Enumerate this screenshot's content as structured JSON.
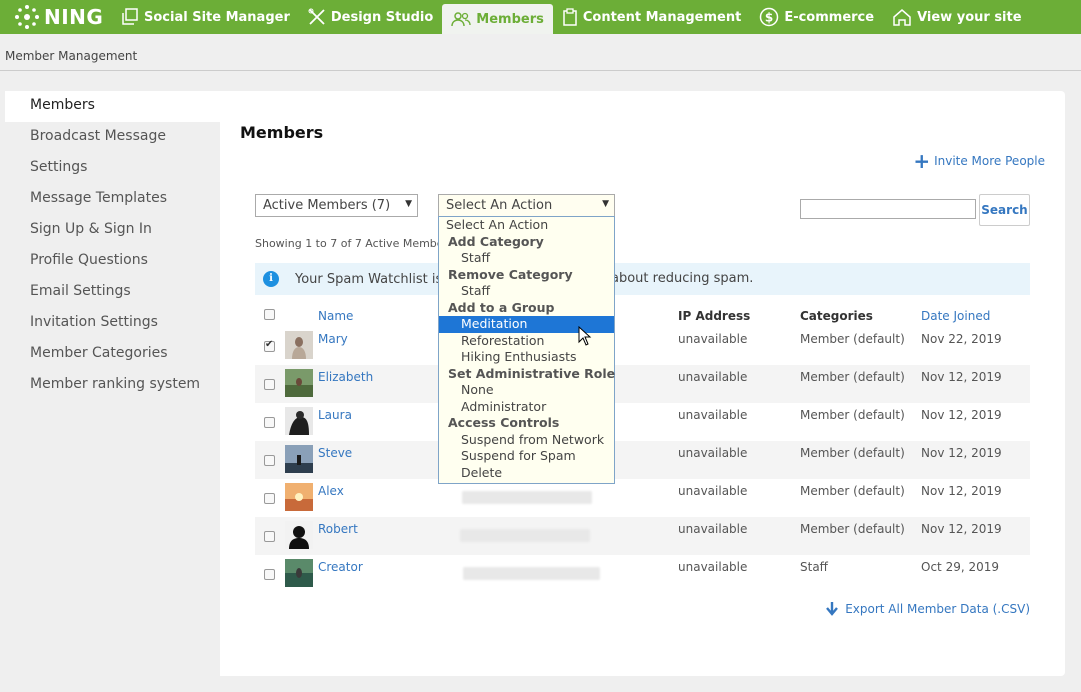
{
  "nav": {
    "logo": "NING",
    "items": [
      {
        "label": "Social Site Manager"
      },
      {
        "label": "Design Studio"
      },
      {
        "label": "Members"
      },
      {
        "label": "Content Management"
      },
      {
        "label": "E-commerce"
      },
      {
        "label": "View your site"
      }
    ]
  },
  "breadcrumb": "Member Management",
  "sidebar": {
    "items": [
      {
        "label": "Members"
      },
      {
        "label": "Broadcast Message"
      },
      {
        "label": "Settings"
      },
      {
        "label": "Message Templates"
      },
      {
        "label": "Sign Up & Sign In"
      },
      {
        "label": "Profile Questions"
      },
      {
        "label": "Email Settings"
      },
      {
        "label": "Invitation Settings"
      },
      {
        "label": "Member Categories"
      },
      {
        "label": "Member ranking system"
      }
    ]
  },
  "main": {
    "title": "Members",
    "invite": "Invite More People",
    "filter_select": "Active Members (7)",
    "action_select": "Select An Action",
    "search_button": "Search",
    "showing": "Showing 1 to 7 of 7 Active Members",
    "info_text_left": "Your Spam Watchlist is",
    "info_text_right": "about reducing spam.",
    "columns": {
      "name": "Name",
      "ip": "IP Address",
      "categories": "Categories",
      "date": "Date Joined"
    },
    "members": [
      {
        "name": "Mary",
        "ip": "unavailable",
        "category": "Member (default)",
        "date": "Nov 22, 2019"
      },
      {
        "name": "Elizabeth",
        "ip": "unavailable",
        "category": "Member (default)",
        "date": "Nov 12, 2019"
      },
      {
        "name": "Laura",
        "ip": "unavailable",
        "category": "Member (default)",
        "date": "Nov 12, 2019"
      },
      {
        "name": "Steve",
        "ip": "unavailable",
        "category": "Member (default)",
        "date": "Nov 12, 2019"
      },
      {
        "name": "Alex",
        "ip": "unavailable",
        "category": "Member (default)",
        "date": "Nov 12, 2019"
      },
      {
        "name": "Robert",
        "ip": "unavailable",
        "category": "Member (default)",
        "date": "Nov 12, 2019"
      },
      {
        "name": "Creator",
        "ip": "unavailable",
        "category": "Staff",
        "date": "Oct 29, 2019"
      }
    ],
    "export": "Export All Member Data (.CSV)"
  },
  "dropdown": {
    "top": "Select An Action",
    "g1": "Add Category",
    "g1_i1": "Staff",
    "g2": "Remove Category",
    "g2_i1": "Staff",
    "g3": "Add to a Group",
    "g3_i1": "Meditation",
    "g3_i2": "Reforestation",
    "g3_i3": "Hiking Enthusiasts",
    "g4": "Set Administrative Role",
    "g4_i1": "None",
    "g4_i2": "Administrator",
    "g5": "Access Controls",
    "g5_i1": "Suspend from Network",
    "g5_i2": "Suspend for Spam",
    "g5_i3": "Delete"
  },
  "colors": {
    "brand": "#6cae37",
    "link": "#3577c0",
    "highlight": "#1e76d6"
  }
}
